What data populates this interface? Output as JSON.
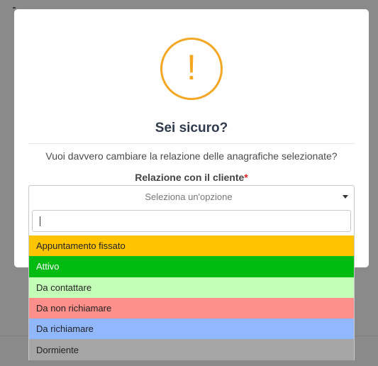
{
  "dialog": {
    "icon": "exclamation-icon",
    "icon_glyph": "!",
    "title": "Sei sicuro?",
    "message": "Vuoi davvero cambiare la relazione delle anagrafiche selezionate?",
    "field_label": "Relazione con il cliente",
    "required_mark": "*",
    "select_placeholder": "Seleziona un'opzione",
    "search_value": "",
    "options": [
      {
        "label": "Appuntamento fissato",
        "color": "#ffc400"
      },
      {
        "label": "Attivo",
        "color": "#00bb11"
      },
      {
        "label": "Da contattare",
        "color": "#c4ffb8"
      },
      {
        "label": "Da non richiamare",
        "color": "#ff8f8a"
      },
      {
        "label": "Da richiamare",
        "color": "#91b8ff"
      },
      {
        "label": "Dormiente",
        "color": "#a5a5a5"
      }
    ]
  },
  "colors": {
    "warning": "#f5a623",
    "title": "#2f3b4d",
    "required": "#e02020"
  }
}
